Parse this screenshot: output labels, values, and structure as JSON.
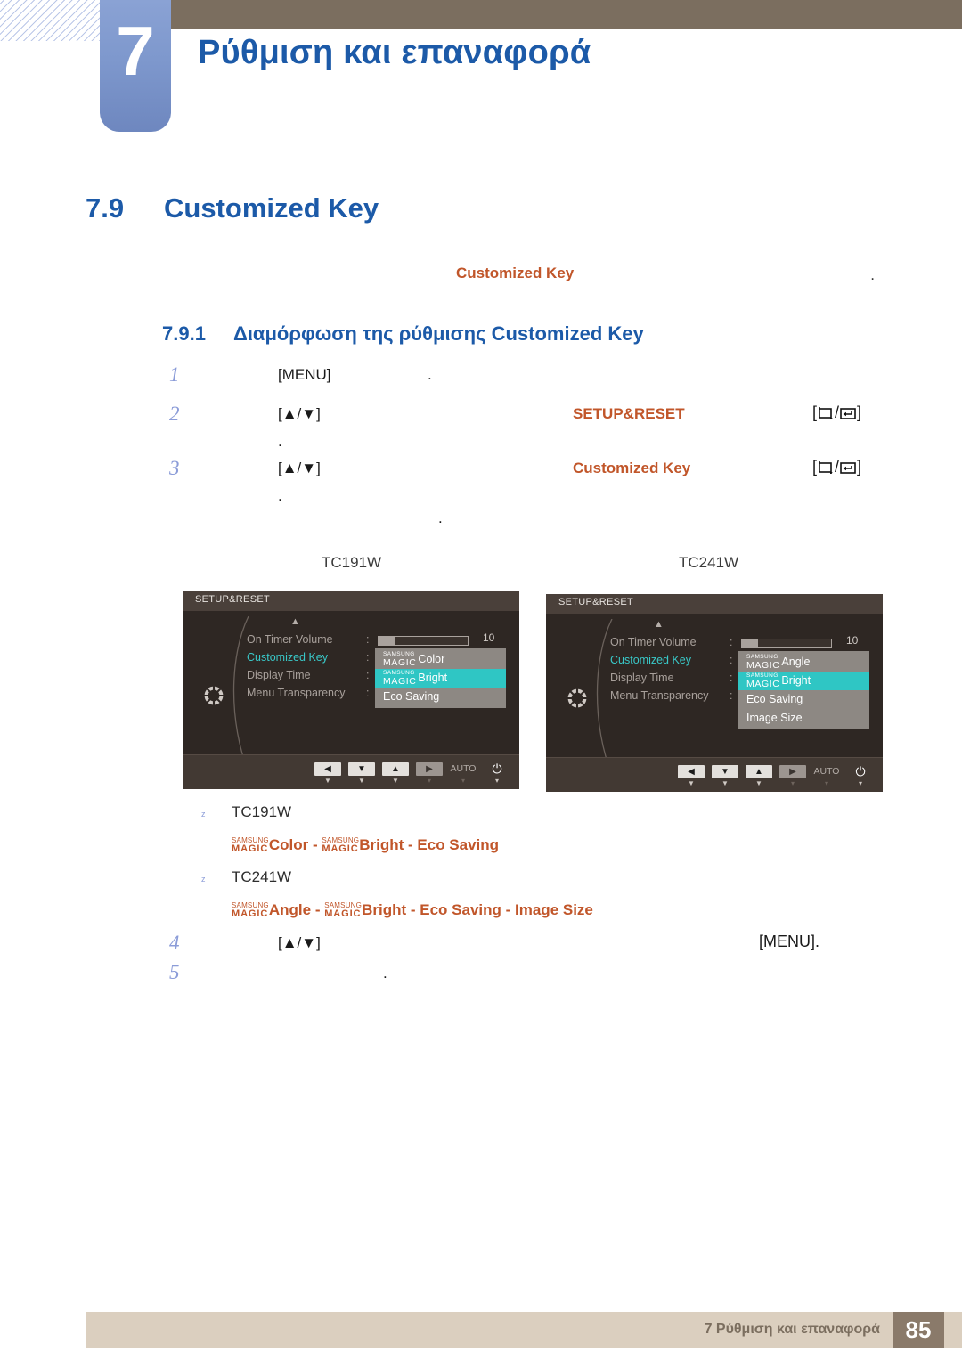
{
  "header": {
    "chapter_number": "7",
    "chapter_title": "Ρύθμιση και επαναφορά",
    "brown_bar_color": "#7b6e5f",
    "tab_color": "#7e98cd",
    "title_color": "#1c5aa8"
  },
  "section": {
    "number": "7.9",
    "title": "Customized Key",
    "lead_keyword": "Customized Key",
    "lead_trailing_dot": "."
  },
  "subsection": {
    "number": "7.9.1",
    "title": "Διαμόρφωση της ρύθμισης Customized Key"
  },
  "steps": [
    {
      "number": "1",
      "key": "[MENU]",
      "dot": ".",
      "keyword": "",
      "button": "",
      "sub_dot": ""
    },
    {
      "number": "2",
      "key": "[▲/▼]",
      "dot": "",
      "keyword": "SETUP&RESET",
      "button": "[□/↵]",
      "sub_dot": "."
    },
    {
      "number": "3",
      "key": "[▲/▼]",
      "dot": "",
      "keyword": "Customized Key",
      "button": "[□/↵]",
      "sub_dot": "."
    }
  ],
  "mid_dot": ".",
  "model_labels": {
    "left": "TC191W",
    "right": "TC241W"
  },
  "osd_left": {
    "title": "SETUP&RESET",
    "menu_items": [
      {
        "label": "On Timer  Volume",
        "selected": false
      },
      {
        "label": "Customized Key",
        "selected": true
      },
      {
        "label": "Display Time",
        "selected": false
      },
      {
        "label": "Menu Transparency",
        "selected": false
      }
    ],
    "volume_value": "10",
    "dropdown": [
      {
        "magic_top": "SAMSUNG",
        "magic_bottom": "MAGIC",
        "label": "Color",
        "highlighted": false
      },
      {
        "magic_top": "SAMSUNG",
        "magic_bottom": "MAGIC",
        "label": "Bright",
        "highlighted": true
      },
      {
        "magic_top": "",
        "magic_bottom": "",
        "label": "Eco Saving",
        "highlighted": false
      }
    ],
    "buttons": [
      {
        "cap": "◀",
        "sub": "▼",
        "style": "light"
      },
      {
        "cap": "▼",
        "sub": "▼",
        "style": "light"
      },
      {
        "cap": "▲",
        "sub": "▼",
        "style": "light"
      },
      {
        "cap": "▶",
        "sub": "▾",
        "style": "dim"
      },
      {
        "cap": "AUTO",
        "sub": "▾",
        "style": "plain"
      },
      {
        "cap": "⏻",
        "sub": "▾",
        "style": "power"
      }
    ]
  },
  "osd_right": {
    "title": "SETUP&RESET",
    "menu_items": [
      {
        "label": "On Timer  Volume",
        "selected": false
      },
      {
        "label": "Customized Key",
        "selected": true
      },
      {
        "label": "Display Time",
        "selected": false
      },
      {
        "label": "Menu Transparency",
        "selected": false
      }
    ],
    "volume_value": "10",
    "dropdown": [
      {
        "magic_top": "SAMSUNG",
        "magic_bottom": "MAGIC",
        "label": "Angle",
        "highlighted": false
      },
      {
        "magic_top": "SAMSUNG",
        "magic_bottom": "MAGIC",
        "label": "Bright",
        "highlighted": true
      },
      {
        "magic_top": "",
        "magic_bottom": "",
        "label": "Eco Saving",
        "highlighted": false
      },
      {
        "magic_top": "",
        "magic_bottom": "",
        "label": "Image Size",
        "highlighted": false
      }
    ],
    "buttons": [
      {
        "cap": "◀",
        "sub": "▼",
        "style": "light"
      },
      {
        "cap": "▼",
        "sub": "▼",
        "style": "light"
      },
      {
        "cap": "▲",
        "sub": "▼",
        "style": "light"
      },
      {
        "cap": "▶",
        "sub": "▾",
        "style": "dim"
      },
      {
        "cap": "AUTO",
        "sub": "▾",
        "style": "plain"
      },
      {
        "cap": "⏻",
        "sub": "▾",
        "style": "power"
      }
    ]
  },
  "bullets": [
    {
      "mark": "z",
      "model": "TC191W",
      "options": [
        {
          "magic_top": "SAMSUNG",
          "magic_bottom": "MAGIC",
          "label": "Color"
        },
        {
          "magic_top": "SAMSUNG",
          "magic_bottom": "MAGIC",
          "label": "Bright"
        },
        {
          "magic_top": "",
          "magic_bottom": "",
          "label": "Eco Saving"
        }
      ]
    },
    {
      "mark": "z",
      "model": "TC241W",
      "options": [
        {
          "magic_top": "SAMSUNG",
          "magic_bottom": "MAGIC",
          "label": "Angle"
        },
        {
          "magic_top": "SAMSUNG",
          "magic_bottom": "MAGIC",
          "label": "Bright"
        },
        {
          "magic_top": "",
          "magic_bottom": "",
          "label": "Eco Saving"
        },
        {
          "magic_top": "",
          "magic_bottom": "",
          "label": "Image Size"
        }
      ]
    }
  ],
  "steps_tail": [
    {
      "number": "4",
      "key": "[▲/▼]",
      "tail": "[MENU]."
    },
    {
      "number": "5",
      "key": "",
      "dot": "."
    }
  ],
  "footer": {
    "text": "7 Ρύθμιση και επαναφορά",
    "page": "85",
    "bar_color": "#dbcfbf",
    "page_color": "#8a7a6a"
  }
}
